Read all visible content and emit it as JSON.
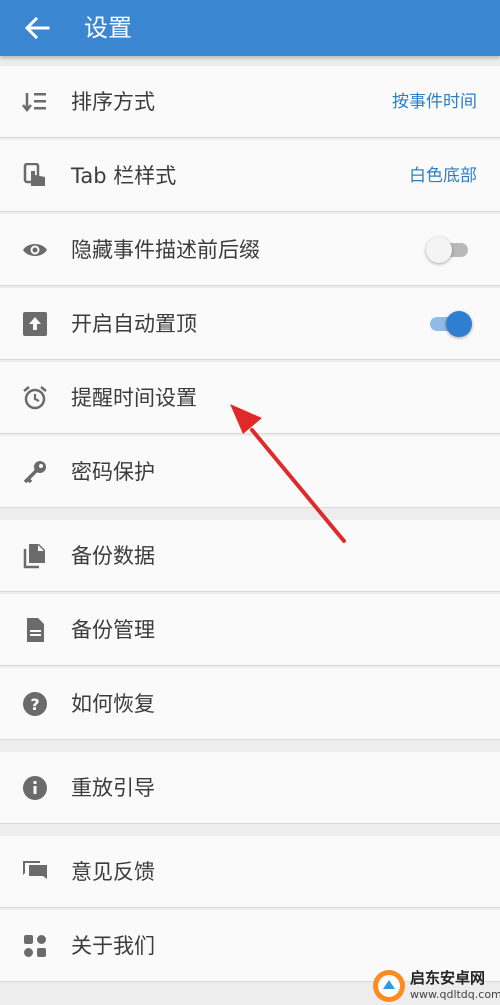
{
  "appbar": {
    "title": "设置",
    "back_icon": "arrow-back-icon"
  },
  "colors": {
    "primary": "#3a86d0",
    "accent_value": "#2a7fc7",
    "arrow": "#e02a2a"
  },
  "settings": [
    {
      "icon": "sort-icon",
      "label": "排序方式",
      "value": "按事件时间"
    },
    {
      "icon": "touch-icon",
      "label": "Tab 栏样式",
      "value": "白色底部"
    },
    {
      "icon": "eye-icon",
      "label": "隐藏事件描述前后缀",
      "toggle": "off"
    },
    {
      "icon": "upload-box-icon",
      "label": "开启自动置顶",
      "toggle": "on"
    },
    {
      "icon": "alarm-clock-icon",
      "label": "提醒时间设置"
    },
    {
      "icon": "key-icon",
      "label": "密码保护"
    },
    {
      "icon": "copy-file-icon",
      "label": "备份数据"
    },
    {
      "icon": "document-icon",
      "label": "备份管理"
    },
    {
      "icon": "help-circle-icon",
      "label": "如何恢复"
    },
    {
      "icon": "info-icon",
      "label": "重放引导"
    },
    {
      "icon": "feedback-chat-icon",
      "label": "意见反馈"
    },
    {
      "icon": "app-grid-icon",
      "label": "关于我们"
    }
  ],
  "watermark": {
    "title": "启东安卓网",
    "url": "www.qdltdq.com"
  }
}
